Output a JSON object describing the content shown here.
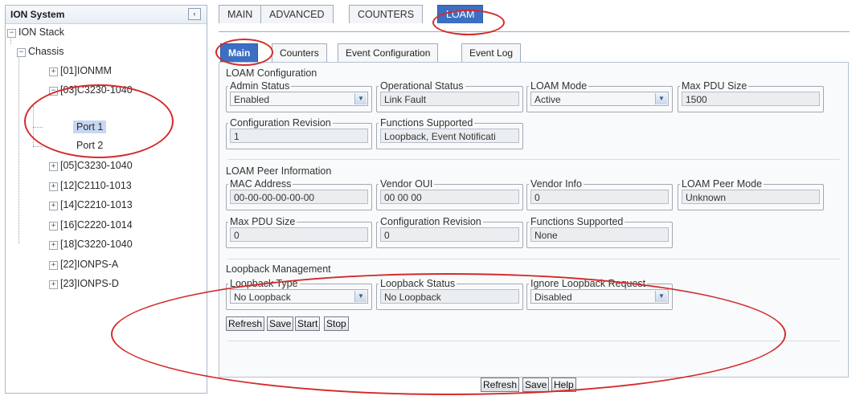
{
  "left_panel": {
    "title": "ION System",
    "collapse_glyph": "‹",
    "tree": [
      {
        "label": "ION Stack",
        "toggle": "−"
      },
      {
        "label": "Chassis",
        "toggle": "−"
      },
      {
        "label": "[01]IONMM",
        "toggle": "+"
      },
      {
        "label": "[03]C3230-1040",
        "toggle": "−"
      },
      {
        "label": "Port 1",
        "toggle": ""
      },
      {
        "label": "Port 2",
        "toggle": ""
      },
      {
        "label": "[05]C3230-1040",
        "toggle": "+"
      },
      {
        "label": "[12]C2110-1013",
        "toggle": "+"
      },
      {
        "label": "[14]C2210-1013",
        "toggle": "+"
      },
      {
        "label": "[16]C2220-1014",
        "toggle": "+"
      },
      {
        "label": "[18]C3220-1040",
        "toggle": "+"
      },
      {
        "label": "[22]IONPS-A",
        "toggle": "+"
      },
      {
        "label": "[23]IONPS-D",
        "toggle": "+"
      }
    ]
  },
  "top_tabs": [
    "MAIN",
    "ADVANCED",
    "COUNTERS",
    "LOAM"
  ],
  "sub_tabs": [
    "Main",
    "Counters",
    "Event Configuration",
    "Event Log"
  ],
  "loam_config": {
    "title": "LOAM Configuration",
    "admin_status": {
      "label": "Admin Status",
      "value": "Enabled"
    },
    "operational_status": {
      "label": "Operational Status",
      "value": "Link Fault"
    },
    "loam_mode": {
      "label": "LOAM Mode",
      "value": "Active"
    },
    "max_pdu_size": {
      "label": "Max PDU Size",
      "value": "1500"
    },
    "config_revision": {
      "label": "Configuration Revision",
      "value": "1"
    },
    "functions_supported": {
      "label": "Functions Supported",
      "value": "Loopback, Event Notificati"
    }
  },
  "peer_info": {
    "title": "LOAM Peer Information",
    "mac_address": {
      "label": "MAC Address",
      "value": "00-00-00-00-00-00"
    },
    "vendor_oui": {
      "label": "Vendor OUI",
      "value": "00 00 00"
    },
    "vendor_info": {
      "label": "Vendor Info",
      "value": "0"
    },
    "peer_mode": {
      "label": "LOAM Peer Mode",
      "value": "Unknown"
    },
    "max_pdu_size": {
      "label": "Max PDU Size",
      "value": "0"
    },
    "config_revision": {
      "label": "Configuration Revision",
      "value": "0"
    },
    "functions_supported": {
      "label": "Functions Supported",
      "value": "None"
    }
  },
  "loopback": {
    "title": "Loopback Management",
    "type": {
      "label": "Loopback Type",
      "value": "No Loopback"
    },
    "status": {
      "label": "Loopback Status",
      "value": "No Loopback"
    },
    "ignore_request": {
      "label": "Ignore Loopback Request",
      "value": "Disabled"
    },
    "buttons": {
      "refresh": "Refresh",
      "save": "Save",
      "start": "Start",
      "stop": "Stop"
    }
  },
  "bottom_buttons": {
    "refresh": "Refresh",
    "save": "Save",
    "help": "Help"
  },
  "colors": {
    "highlight_ellipse": "#d42a2a",
    "active_tab": "#3c6fc3",
    "tree_selected": "#c5d8f2"
  },
  "icons": {
    "dropdown": "chevron-down-icon",
    "collapse": "collapse-panel-icon",
    "tree_toggle": "tree-expand-icon"
  }
}
